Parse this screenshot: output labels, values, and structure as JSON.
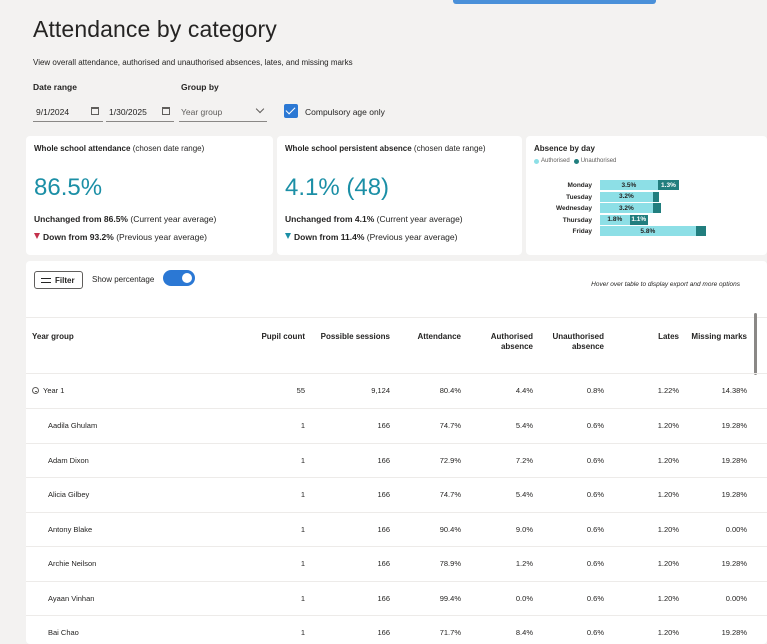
{
  "page": {
    "title": "Attendance by category",
    "subtitle": "View overall attendance, authorised and unauthorised absences, lates, and missing marks"
  },
  "filters": {
    "date_range_label": "Date range",
    "date_start": "9/1/2024",
    "date_end": "1/30/2025",
    "group_by_label": "Group by",
    "group_by_value": "Year group",
    "compulsory_label": "Compulsory age only",
    "compulsory_checked": true
  },
  "cards": {
    "attendance": {
      "title_bold": "Whole school attendance",
      "title_rest": " (chosen date range)",
      "value": "86.5%",
      "line1_bold": "Unchanged from 86.5%",
      "line1_rest": " (Current year average)",
      "line2_bold": "Down from 93.2%",
      "line2_rest": " (Previous year average)"
    },
    "persistent": {
      "title_bold": "Whole school persistent absence",
      "title_rest": " (chosen date range)",
      "value": "4.1% (48)",
      "line1_bold": "Unchanged from 4.1%",
      "line1_rest": " (Current year average)",
      "line2_bold": "Down from 11.4%",
      "line2_rest": " (Previous year average)"
    },
    "absence_by_day": {
      "title": "Absence by day",
      "legend_authorised": "Authorised",
      "legend_unauthorised": "Unauthorised"
    }
  },
  "chart_data": {
    "type": "bar",
    "title": "Absence by day",
    "orientation": "horizontal",
    "stacked": true,
    "categories": [
      "Monday",
      "Tuesday",
      "Wednesday",
      "Thursday",
      "Friday"
    ],
    "series": [
      {
        "name": "Authorised",
        "values": [
          3.5,
          3.2,
          3.2,
          1.8,
          5.8
        ],
        "labels": [
          "3.5%",
          "3.2%",
          "3.2%",
          "1.8%",
          "5.8%"
        ],
        "color": "#8ddfe6"
      },
      {
        "name": "Unauthorised",
        "values": [
          1.3,
          0.4,
          0.5,
          1.1,
          0.6
        ],
        "labels": [
          "1.3%",
          "",
          "",
          "1.1%",
          ""
        ],
        "color": "#217e7e"
      }
    ],
    "legend": "top-left"
  },
  "table_controls": {
    "filter_label": "Filter",
    "show_percentage_label": "Show percentage",
    "show_percentage_on": true,
    "hover_note": "Hover over table to display export and more options"
  },
  "table": {
    "headers": {
      "year_group": "Year group",
      "pupil_count": "Pupil count",
      "possible_sessions": "Possible sessions",
      "attendance": "Attendance",
      "authorised_1": "Authorised",
      "authorised_2": "absence",
      "unauthorised_1": "Unauthorised",
      "unauthorised_2": "absence",
      "lates": "Lates",
      "missing_marks": "Missing marks"
    },
    "group": {
      "name": "Year 1",
      "pupils": "55",
      "sessions": "9,124",
      "attendance": "80.4%",
      "authorised": "4.4%",
      "unauthorised": "0.8%",
      "lates": "1.22%",
      "missing": "14.38%"
    },
    "rows": [
      {
        "name": "Aadila Ghulam",
        "pupils": "1",
        "sessions": "166",
        "attendance": "74.7%",
        "authorised": "5.4%",
        "unauthorised": "0.6%",
        "lates": "1.20%",
        "missing": "19.28%"
      },
      {
        "name": "Adam Dixon",
        "pupils": "1",
        "sessions": "166",
        "attendance": "72.9%",
        "authorised": "7.2%",
        "unauthorised": "0.6%",
        "lates": "1.20%",
        "missing": "19.28%"
      },
      {
        "name": "Alicia Gilbey",
        "pupils": "1",
        "sessions": "166",
        "attendance": "74.7%",
        "authorised": "5.4%",
        "unauthorised": "0.6%",
        "lates": "1.20%",
        "missing": "19.28%"
      },
      {
        "name": "Antony Blake",
        "pupils": "1",
        "sessions": "166",
        "attendance": "90.4%",
        "authorised": "9.0%",
        "unauthorised": "0.6%",
        "lates": "1.20%",
        "missing": "0.00%"
      },
      {
        "name": "Archie Neilson",
        "pupils": "1",
        "sessions": "166",
        "attendance": "78.9%",
        "authorised": "1.2%",
        "unauthorised": "0.6%",
        "lates": "1.20%",
        "missing": "19.28%"
      },
      {
        "name": "Ayaan Vinhan",
        "pupils": "1",
        "sessions": "166",
        "attendance": "99.4%",
        "authorised": "0.0%",
        "unauthorised": "0.6%",
        "lates": "1.20%",
        "missing": "0.00%"
      },
      {
        "name": "Bai Chao",
        "pupils": "1",
        "sessions": "166",
        "attendance": "71.7%",
        "authorised": "8.4%",
        "unauthorised": "0.6%",
        "lates": "1.20%",
        "missing": "19.28%"
      }
    ]
  }
}
